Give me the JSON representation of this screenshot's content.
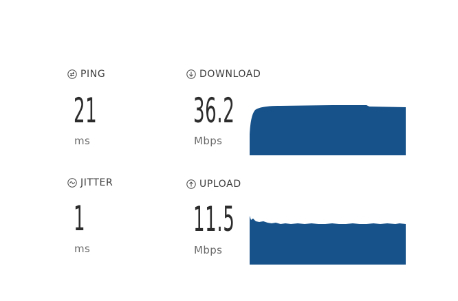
{
  "metrics": {
    "ping": {
      "label": "PING",
      "value": "21",
      "unit": "ms",
      "icon": "ping-icon"
    },
    "jitter": {
      "label": "JITTER",
      "value": "1",
      "unit": "ms",
      "icon": "jitter-icon"
    },
    "download": {
      "label": "DOWNLOAD",
      "value": "36.2",
      "unit": "Mbps",
      "icon": "download-arrow-icon"
    },
    "upload": {
      "label": "UPLOAD",
      "value": "11.5",
      "unit": "Mbps",
      "icon": "upload-arrow-icon"
    }
  },
  "colors": {
    "graph_fill": "#17528a",
    "text": "#333333",
    "unit_text": "#6a6a6a"
  }
}
